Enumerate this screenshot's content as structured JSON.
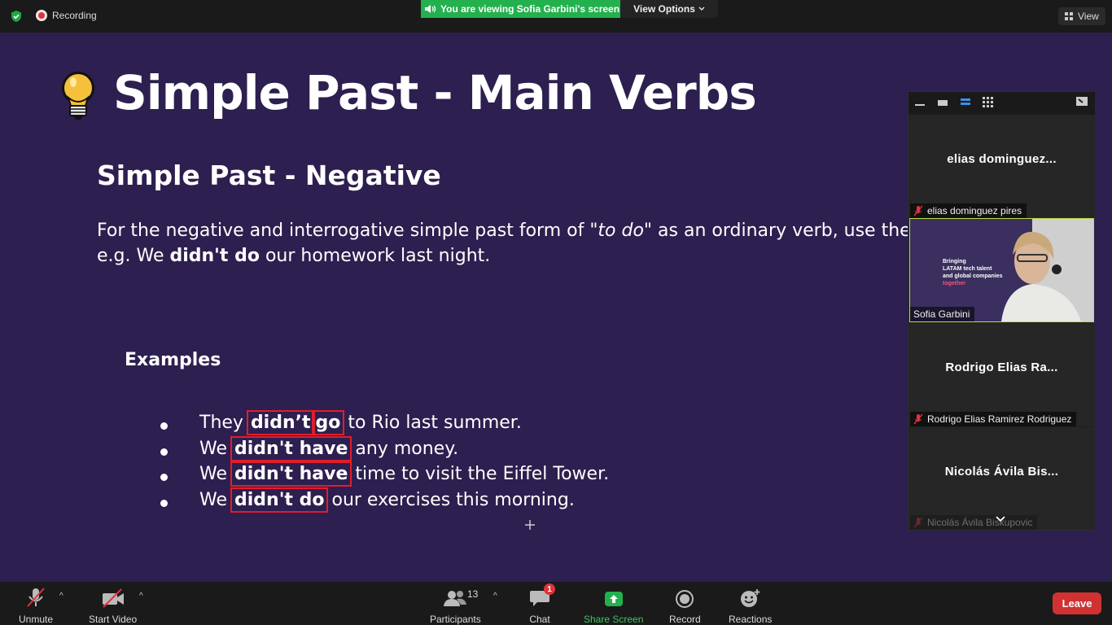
{
  "topbar": {
    "recording_label": "Recording",
    "viewing_text": "You are viewing Sofia Garbini's screen",
    "view_options_label": "View Options",
    "view_label": "View"
  },
  "slide": {
    "title": "Simple Past - Main Verbs",
    "subtitle": "Simple Past - Negative",
    "body_line1_pre": "For the negative and interrogative simple past form of ",
    "body_line1_italic": "\"to do\"",
    "body_line1_post": " as an ordinary verb, use the au",
    "body_line2_pre": "e.g. We ",
    "body_line2_bold": "didn't do",
    "body_line2_post": " our homework last night.",
    "examples_heading": "Examples",
    "examples": [
      {
        "pre": "They ",
        "bold1": "didn’t",
        "bold2": "go",
        "post": " to Rio last summer."
      },
      {
        "pre": "We ",
        "bold1": "didn't have",
        "post": " any money."
      },
      {
        "pre": "We ",
        "bold1": "didn't have",
        "post": " time to visit the Eiffel Tower."
      },
      {
        "pre": "We ",
        "bold1": "didn't do",
        "post": " our exercises this morning."
      }
    ]
  },
  "video_panel": {
    "tiles": [
      {
        "display_name": "elias  dominguez...",
        "label": "elias dominguez pires"
      },
      {
        "video_overlay_lines": [
          "Bringing",
          "LATAM tech talent",
          "and global companies",
          "together"
        ],
        "label": "Sofia Garbini"
      },
      {
        "display_name": "Rodrigo  Elias  Ra...",
        "label": "Rodrigo Elias Ramirez Rodriguez"
      },
      {
        "display_name": "Nicolás  Ávila  Bis...",
        "label": "Nicolás Ávila Biskupovic"
      }
    ]
  },
  "toolbar": {
    "unmute_label": "Unmute",
    "start_video_label": "Start Video",
    "participants_label": "Participants",
    "participants_count": "13",
    "chat_label": "Chat",
    "chat_badge": "1",
    "share_screen_label": "Share Screen",
    "record_label": "Record",
    "reactions_label": "Reactions",
    "leave_label": "Leave"
  },
  "colors": {
    "slide_background": "#2d1f4f",
    "share_green": "#23b14d",
    "highlight_red": "#e01e2b",
    "leave_red": "#d13131"
  }
}
